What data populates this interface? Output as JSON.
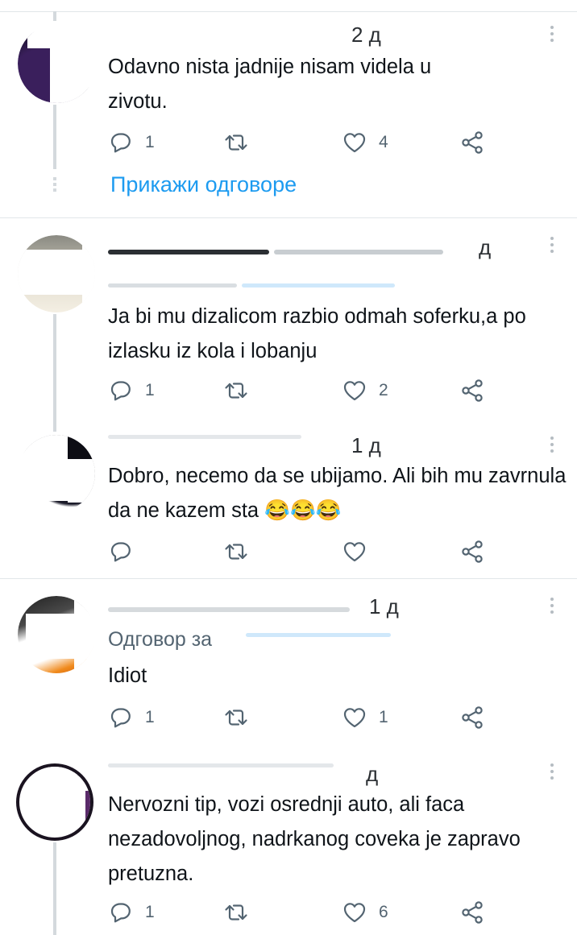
{
  "comments": [
    {
      "time": "2 д",
      "text": "Odavno nista jadnije nisam videla u zivotu.",
      "reply_count": "1",
      "retweet_count": "",
      "like_count": "4",
      "show_replies": "Прикажи одговоре"
    },
    {
      "time": "д",
      "text": "Ja bi mu dizalicom razbio odmah soferku,a po izlasku iz kola i lobanju",
      "reply_count": "1",
      "retweet_count": "",
      "like_count": "2"
    },
    {
      "time": "1 д",
      "text": "Dobro, necemo da se ubijamo. Ali bih mu zavrnula da ne kazem sta 😂😂😂",
      "reply_count": "",
      "retweet_count": "",
      "like_count": ""
    },
    {
      "time": "1 д",
      "reply_to_label": "Одговор за",
      "text": "Idiot",
      "reply_count": "1",
      "retweet_count": "",
      "like_count": "1"
    },
    {
      "time": "д",
      "text": "Nervozni tip, vozi osrednji auto, ali faca nezadovoljnog, nadrkanog coveka je zapravo pretuzna.",
      "reply_count": "1",
      "retweet_count": "",
      "like_count": "6"
    }
  ],
  "icons": {
    "reply": "reply-icon",
    "retweet": "retweet-icon",
    "like": "heart-icon",
    "share": "share-icon",
    "more": "more-icon"
  },
  "colors": {
    "text": "#0f1419",
    "secondary": "#536471",
    "link": "#1d9bf0",
    "divider": "#e1e6e9",
    "thread_line": "#d4d9dd"
  }
}
